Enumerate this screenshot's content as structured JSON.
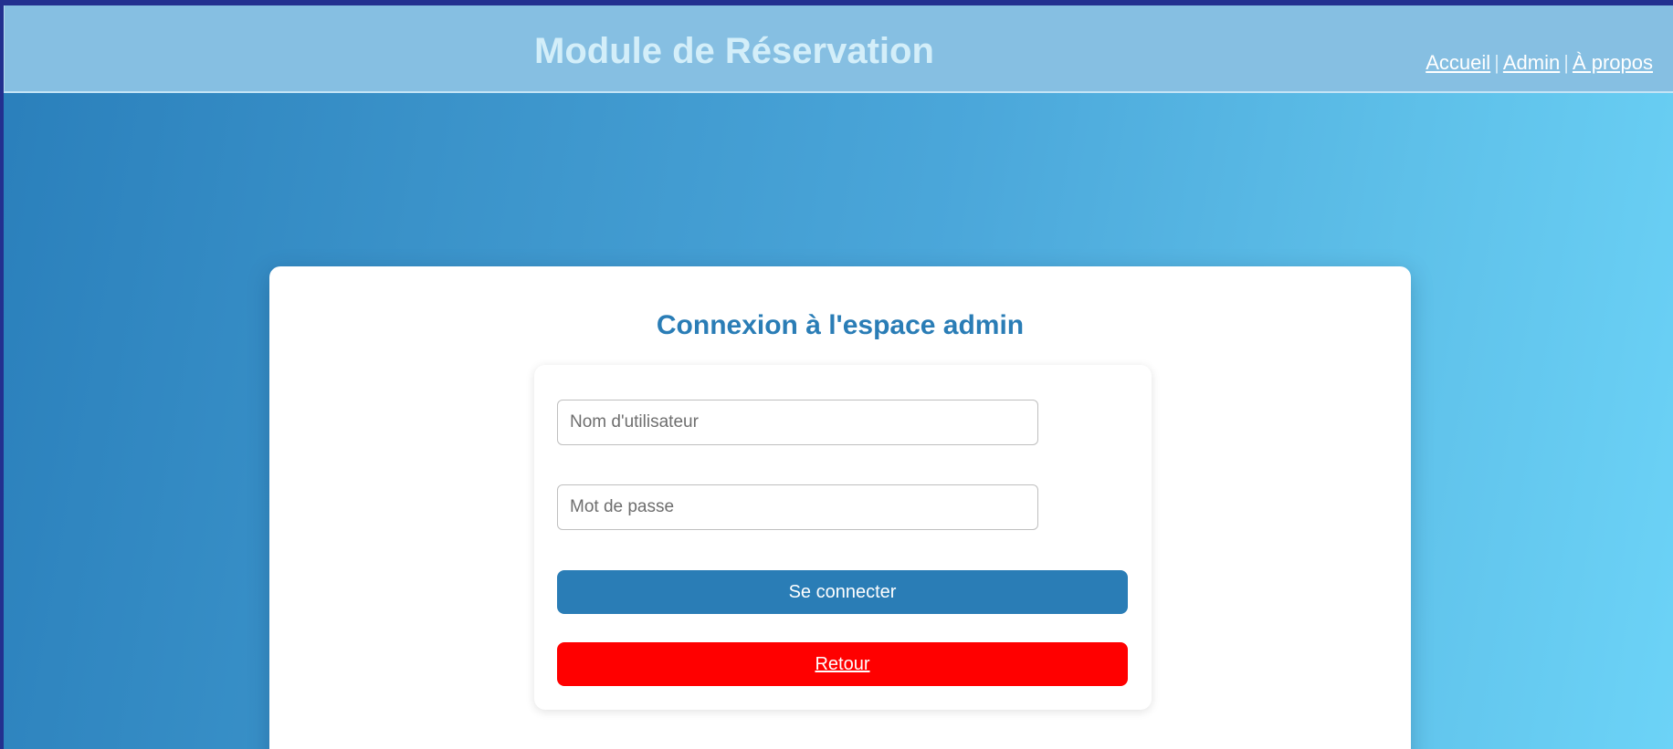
{
  "header": {
    "title": "Module de Réservation",
    "nav": [
      {
        "label": "Accueil"
      },
      {
        "label": "Admin"
      },
      {
        "label": "À propos"
      }
    ],
    "separator": "|"
  },
  "login": {
    "title": "Connexion à l'espace admin",
    "username_placeholder": "Nom d'utilisateur",
    "password_placeholder": "Mot de passe",
    "submit_label": "Se connecter",
    "back_label": "Retour"
  },
  "colors": {
    "primary": "#2a7db6",
    "danger": "#ff0000",
    "header_bg": "#86bfe2"
  }
}
